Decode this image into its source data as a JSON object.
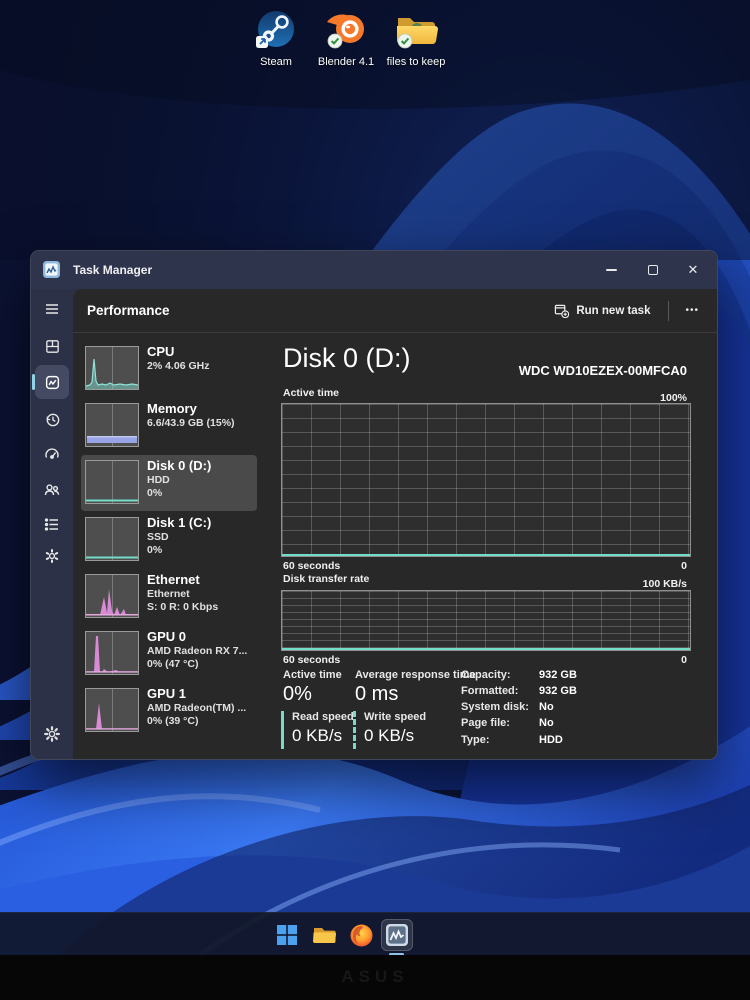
{
  "desktop": {
    "icons": [
      {
        "label": "Steam"
      },
      {
        "label": "Blender 4.1"
      },
      {
        "label": "files to keep"
      }
    ]
  },
  "window": {
    "title": "Task Manager",
    "controls": {
      "close": "✕"
    },
    "header": {
      "title": "Performance",
      "run_new_task": "Run new task",
      "more": "•••"
    },
    "perf_list": [
      {
        "name": "CPU",
        "line1": "2%  4.06 GHz",
        "line2": ""
      },
      {
        "name": "Memory",
        "line1": "6.6/43.9 GB (15%)",
        "line2": ""
      },
      {
        "name": "Disk 0 (D:)",
        "line1": "HDD",
        "line2": "0%"
      },
      {
        "name": "Disk 1 (C:)",
        "line1": "SSD",
        "line2": "0%"
      },
      {
        "name": "Ethernet",
        "line1": "Ethernet",
        "line2": "S: 0 R: 0 Kbps"
      },
      {
        "name": "GPU 0",
        "line1": "AMD Radeon RX 7...",
        "line2": "0% (47 °C)"
      },
      {
        "name": "GPU 1",
        "line1": "AMD Radeon(TM) ...",
        "line2": "0% (39 °C)"
      }
    ],
    "detail": {
      "title": "Disk 0 (D:)",
      "device": "WDC WD10EZEX-00MFCA0",
      "chart1": {
        "label": "Active time",
        "max": "100%",
        "x_label": "60 seconds",
        "min": "0"
      },
      "chart2": {
        "label": "Disk transfer rate",
        "max": "100 KB/s",
        "x_label": "60 seconds",
        "min": "0"
      },
      "stats": {
        "active_time_label": "Active time",
        "active_time_value": "0%",
        "avg_response_label": "Average response time",
        "avg_response_value": "0 ms",
        "read_label": "Read speed",
        "read_value": "0 KB/s",
        "write_label": "Write speed",
        "write_value": "0 KB/s",
        "details": [
          {
            "label": "Capacity:",
            "value": "932 GB"
          },
          {
            "label": "Formatted:",
            "value": "932 GB"
          },
          {
            "label": "System disk:",
            "value": "No"
          },
          {
            "label": "Page file:",
            "value": "No"
          },
          {
            "label": "Type:",
            "value": "HDD"
          }
        ]
      }
    }
  },
  "bezel": {
    "brand": "ASUS"
  },
  "colors": {
    "chart_teal": "#74dcc8",
    "nav_accent": "#8fd2ea",
    "memory_band": "#98a4e6",
    "network_pink": "#d98ad4",
    "wall_blue": "#2a63ea"
  },
  "chart_data": [
    {
      "type": "area",
      "title": "Active time",
      "ylabel_max": "100%",
      "x_range_label": "60 seconds",
      "ylim": [
        0,
        100
      ],
      "series": [
        {
          "name": "Active time",
          "values": [
            0,
            0,
            0,
            0,
            0,
            0,
            0,
            0,
            0,
            0
          ]
        }
      ]
    },
    {
      "type": "area",
      "title": "Disk transfer rate",
      "ylabel_max": "100 KB/s",
      "x_range_label": "60 seconds",
      "ylim": [
        0,
        100
      ],
      "series": [
        {
          "name": "Transfer rate",
          "values": [
            0,
            0,
            0,
            0,
            0,
            0,
            0,
            0,
            0,
            0
          ]
        }
      ]
    }
  ]
}
